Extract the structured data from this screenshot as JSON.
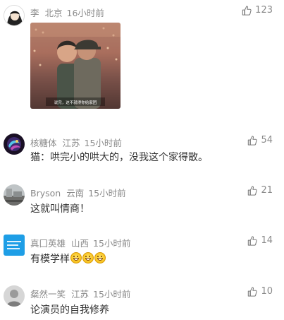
{
  "comments": [
    {
      "user": "李",
      "location": "北京",
      "time": "16小时前",
      "likes": "123",
      "text": "",
      "photo_caption": "说完，这不就得你给家团"
    },
    {
      "user": "核糖体",
      "location": "江苏",
      "time": "15小时前",
      "likes": "54",
      "text": "猫：哄完小的哄大的，没我这个家得散。"
    },
    {
      "user": "Bryson",
      "location": "云南",
      "time": "15小时前",
      "likes": "21",
      "text": "这就叫情商！"
    },
    {
      "user": "真囗英雄",
      "location": "山西",
      "time": "15小时前",
      "likes": "14",
      "text": "有模学样",
      "emoji": [
        "grin-emoji",
        "grin-emoji",
        "grin-emoji"
      ]
    },
    {
      "user": "粲然一笑",
      "location": "江苏",
      "time": "15小时前",
      "likes": "10",
      "text": "论演员的自我修养"
    }
  ],
  "icons": {
    "like": "thumbs-up-icon"
  },
  "colors": {
    "meta": "#8a8a8a",
    "text": "#333333"
  }
}
